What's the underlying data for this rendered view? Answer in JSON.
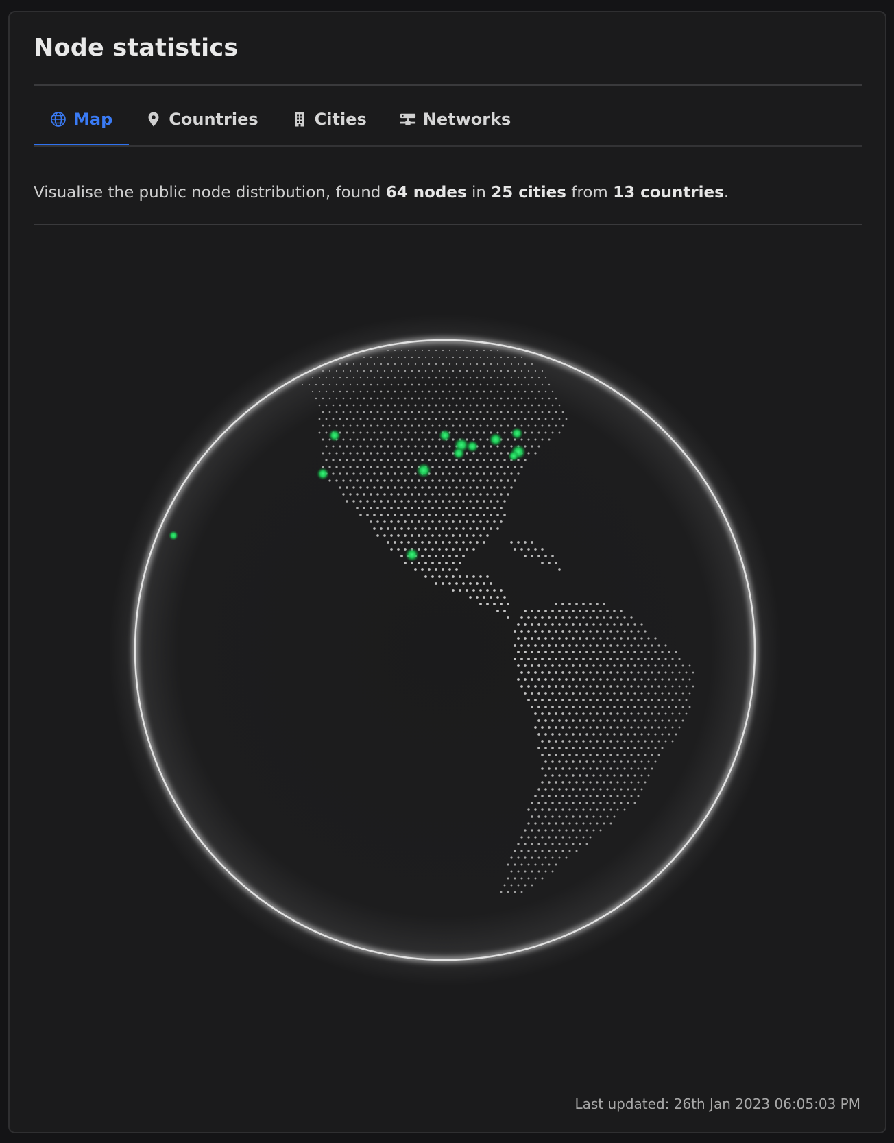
{
  "header": {
    "title": "Node statistics"
  },
  "tabs": [
    {
      "label": "Map",
      "icon": "globe-icon",
      "active": true
    },
    {
      "label": "Countries",
      "icon": "map-pin-icon",
      "active": false
    },
    {
      "label": "Cities",
      "icon": "building-icon",
      "active": false
    },
    {
      "label": "Networks",
      "icon": "network-icon",
      "active": false
    }
  ],
  "summary": {
    "prefix": "Visualise the public node distribution, found",
    "nodes": "64 nodes",
    "in": "in",
    "cities": "25 cities",
    "from": "from",
    "countries": "13 countries",
    "end": "."
  },
  "footer": {
    "last_updated": "Last updated: 26th Jan 2023 06:05:03 PM"
  },
  "colors": {
    "accent": "#2f72f0",
    "node_marker": "#22d35e",
    "land_dot": "#e0e0e0",
    "globe_rim": "#d9d9d9"
  }
}
